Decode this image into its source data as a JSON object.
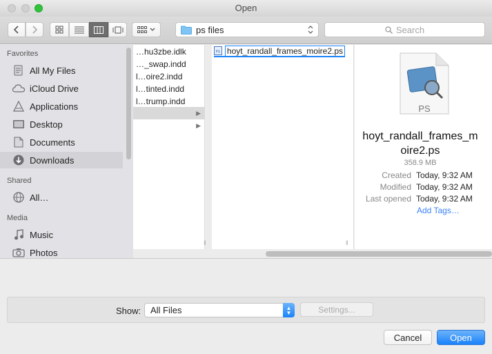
{
  "window": {
    "title": "Open"
  },
  "toolbar": {
    "path": "ps files",
    "search_placeholder": "Search"
  },
  "sidebar": {
    "sections": {
      "favorites": "Favorites",
      "shared": "Shared",
      "media": "Media"
    },
    "favorites": [
      {
        "label": "All My Files",
        "icon": "all-files-icon"
      },
      {
        "label": "iCloud Drive",
        "icon": "cloud-icon"
      },
      {
        "label": "Applications",
        "icon": "applications-icon"
      },
      {
        "label": "Desktop",
        "icon": "desktop-icon"
      },
      {
        "label": "Documents",
        "icon": "documents-icon"
      },
      {
        "label": "Downloads",
        "icon": "downloads-icon",
        "selected": true
      }
    ],
    "shared": [
      {
        "label": "All…",
        "icon": "network-icon"
      }
    ],
    "media": [
      {
        "label": "Music",
        "icon": "music-icon"
      },
      {
        "label": "Photos",
        "icon": "camera-icon"
      }
    ]
  },
  "browser": {
    "col1": [
      "…hu3zbe.idlk",
      "…_swap.indd",
      "l…oire2.indd",
      "l…tinted.indd",
      "l…trump.indd"
    ],
    "col2_selected": "hoyt_randall_frames_moire2.ps"
  },
  "preview": {
    "icon_label": "PS",
    "filename_line1": "hoyt_randall_frames_m",
    "filename_line2": "oire2.ps",
    "size": "358.9 MB",
    "created_label": "Created",
    "created_value": "Today, 9:32 AM",
    "modified_label": "Modified",
    "modified_value": "Today, 9:32 AM",
    "opened_label": "Last opened",
    "opened_value": "Today, 9:32 AM",
    "add_tags": "Add Tags…"
  },
  "footer": {
    "show_label": "Show:",
    "show_value": "All Files",
    "settings_label": "Settings...",
    "cancel_label": "Cancel",
    "open_label": "Open"
  },
  "colors": {
    "accent": "#1a82fb",
    "sidebar_bg": "#e2e2e6",
    "link": "#3b82f6"
  }
}
